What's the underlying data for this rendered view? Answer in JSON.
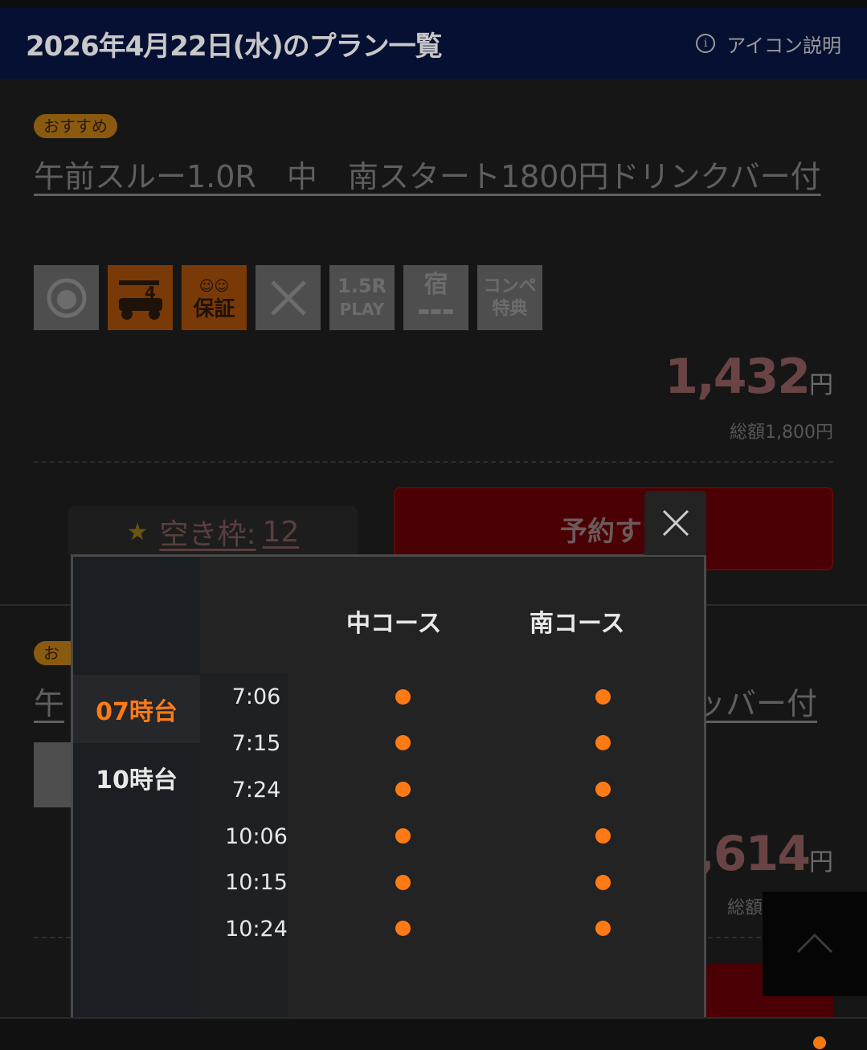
{
  "header": {
    "title": "2026年4月22日(水)のプラン一覧",
    "help_label": "アイコン説明"
  },
  "plan1": {
    "badge": "おすすめ",
    "title": "午前スルー1.0R　中　南スタート1800円ドリンクバー付",
    "icons": [
      {
        "name": "caddie-icon",
        "label": "",
        "active": false
      },
      {
        "name": "cart-4-icon",
        "label": "4",
        "active": true
      },
      {
        "name": "guarantee-icon",
        "label": "保証",
        "active": true
      },
      {
        "name": "meal-icon",
        "label": "",
        "active": false
      },
      {
        "name": "play-1-5r-icon",
        "label": "1.5R PLAY",
        "active": false
      },
      {
        "name": "lodging-icon",
        "label": "宿",
        "active": false
      },
      {
        "name": "compe-icon",
        "label": "コンペ特典",
        "active": false
      }
    ],
    "price": "1,432",
    "price_unit": "円",
    "total": "総額1,800円",
    "availability_label": "空き枠:",
    "availability_count": "12",
    "reserve_label": "予約す"
  },
  "plan2_partial": {
    "badge": "おす",
    "title_start": "午",
    "title_end": "ッバー付",
    "price": ",614",
    "price_unit": "円",
    "total": "総額"
  },
  "popup": {
    "courses": [
      "中コース",
      "南コース"
    ],
    "hour_tabs": [
      {
        "label": "07時台",
        "active": true
      },
      {
        "label": "10時台",
        "active": false
      }
    ],
    "times": [
      {
        "time": "7:06",
        "naka": true,
        "minami": true
      },
      {
        "time": "7:15",
        "naka": true,
        "minami": true
      },
      {
        "time": "7:24",
        "naka": true,
        "minami": true
      },
      {
        "time": "10:06",
        "naka": true,
        "minami": true
      },
      {
        "time": "10:15",
        "naka": true,
        "minami": true
      },
      {
        "time": "10:24",
        "naka": true,
        "minami": true
      }
    ],
    "accent_color": "#ff7a14"
  }
}
